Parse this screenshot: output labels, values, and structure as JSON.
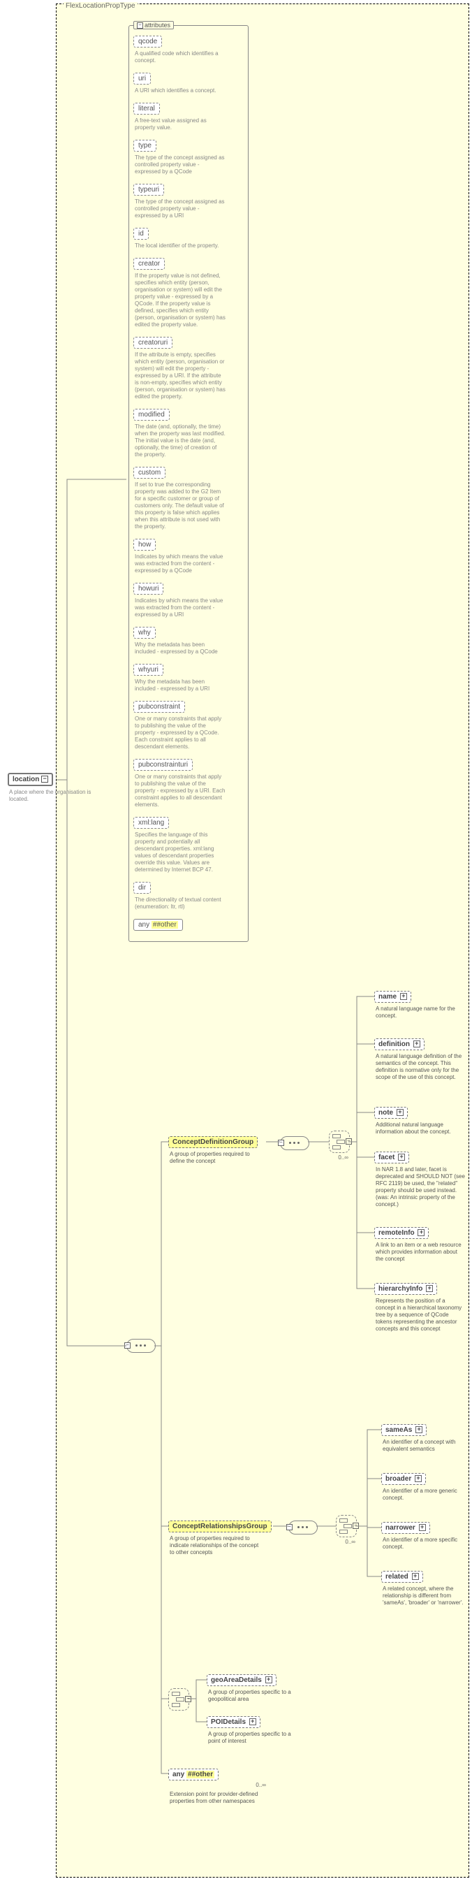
{
  "typeName": "FlexLocationPropType",
  "location": {
    "label": "location",
    "plus": "−",
    "desc": "A place where the organisation is located."
  },
  "attrHeader": "attributes",
  "minus": "−",
  "plus": "+",
  "attrs": [
    {
      "name": "qcode",
      "desc": "A qualified code which identifies a concept."
    },
    {
      "name": "uri",
      "desc": "A URI which identifies a concept."
    },
    {
      "name": "literal",
      "desc": "A free-text value assigned as property value."
    },
    {
      "name": "type",
      "desc": "The type of the concept assigned as controlled property value - expressed by a QCode"
    },
    {
      "name": "typeuri",
      "desc": "The type of the concept assigned as controlled property value - expressed by a URI"
    },
    {
      "name": "id",
      "desc": "The local identifier of the property."
    },
    {
      "name": "creator",
      "desc": "If the property value is not defined, specifies which entity (person, organisation or system) will edit the property value - expressed by a QCode. If the property value is defined, specifies which entity (person, organisation or system) has edited the property value."
    },
    {
      "name": "creatoruri",
      "desc": "If the attribute is empty, specifies which entity (person, organisation or system) will edit the property - expressed by a URI. If the attribute is non-empty, specifies which entity (person, organisation or system) has edited the property."
    },
    {
      "name": "modified",
      "desc": "The date (and, optionally, the time) when the property was last modified. The initial value is the date (and, optionally, the time) of creation of the property."
    },
    {
      "name": "custom",
      "desc": "If set to true the corresponding property was added to the G2 Item for a specific customer or group of customers only. The default value of this property is false which applies when this attribute is not used with the property."
    },
    {
      "name": "how",
      "desc": "Indicates by which means the value was extracted from the content - expressed by a QCode"
    },
    {
      "name": "howuri",
      "desc": "Indicates by which means the value was extracted from the content - expressed by a URI"
    },
    {
      "name": "why",
      "desc": "Why the metadata has been included - expressed by a QCode"
    },
    {
      "name": "whyuri",
      "desc": "Why the metadata has been included - expressed by a URI"
    },
    {
      "name": "pubconstraint",
      "desc": "One or many constraints that apply to publishing the value of the property - expressed by a QCode. Each constraint applies to all descendant elements."
    },
    {
      "name": "pubconstrainturi",
      "desc": "One or many constraints that apply to publishing the value of the property - expressed by a URI. Each constraint applies to all descendant elements."
    },
    {
      "name": "xml:lang",
      "desc": "Specifies the language of this property and potentially all descendant properties. xml:lang values of descendant properties override this value. Values are determined by Internet BCP 47."
    },
    {
      "name": "dir",
      "desc": "The directionality of textual content (enumeration: ltr, rtl)"
    }
  ],
  "anyOther": "##other",
  "anyLabel": "any ",
  "groups": {
    "cdg": {
      "label": "ConceptDefinitionGroup",
      "desc": "A group of properties required to define the concept"
    },
    "crg": {
      "label": "ConceptRelationshipsGroup",
      "desc": "A group of properties required to indicate relationships of the concept to other concepts"
    }
  },
  "cdg_children": [
    {
      "name": "name",
      "desc": "A natural language name for the concept."
    },
    {
      "name": "definition",
      "desc": "A natural language definition of the semantics of the concept. This definition is normative only for the scope of the use of this concept."
    },
    {
      "name": "note",
      "desc": "Additional natural language information about the concept."
    },
    {
      "name": "facet",
      "desc": "In NAR 1.8 and later, facet is deprecated and SHOULD NOT (see RFC 2119) be used, the \"related\" property should be used instead.(was: An intrinsic property of the concept.)"
    },
    {
      "name": "remoteInfo",
      "desc": "A link to an item or a web resource which provides information about the concept"
    },
    {
      "name": "hierarchyInfo",
      "desc": "Represents the position of a concept in a hierarchical taxonomy tree by a sequence of QCode tokens representing the ancestor concepts and this concept"
    }
  ],
  "crg_children": [
    {
      "name": "sameAs",
      "desc": "An identifier of a concept with equivalent semantics"
    },
    {
      "name": "broader",
      "desc": "An identifier of a more generic concept."
    },
    {
      "name": "narrower",
      "desc": "An identifier of a more specific concept."
    },
    {
      "name": "related",
      "desc": "A related concept, where the relationship is different from 'sameAs', 'broader' or 'narrower'."
    }
  ],
  "choice": {
    "geo": {
      "label": "geoAreaDetails",
      "desc": "A group of properties specific to a geopolitical area"
    },
    "poi": {
      "label": "POIDetails",
      "desc": "A group of properties specific to a point of interest"
    }
  },
  "anyBottom": {
    "desc": "Extension point for provider-defined properties from other namespaces"
  },
  "card_inf": "0..∞"
}
